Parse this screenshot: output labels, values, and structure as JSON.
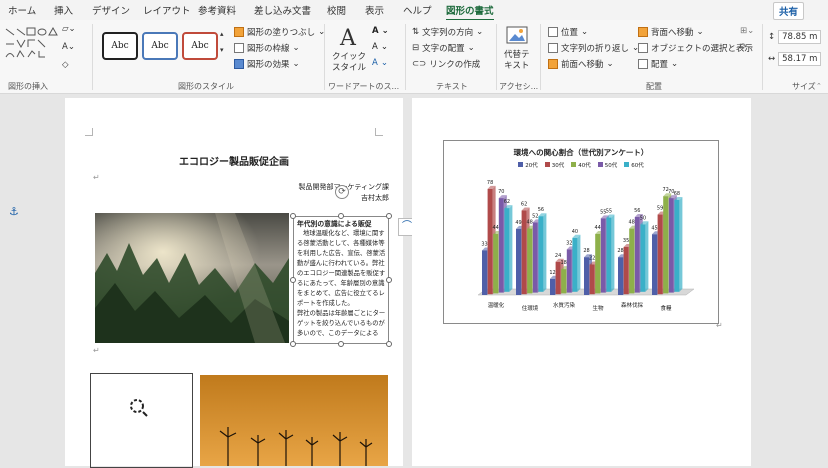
{
  "tabs": [
    "ホーム",
    "挿入",
    "デザイン",
    "レイアウト",
    "参考資料",
    "差し込み文書",
    "校閲",
    "表示",
    "ヘルプ",
    "図形の書式"
  ],
  "share_label": "共有",
  "ribbon": {
    "groups": {
      "insert_shapes": "図形の挿入",
      "shape_styles": "図形のスタイル",
      "wordart_styles": "ワードアートのス...",
      "text": "テキスト",
      "accessibility": "アクセシ...",
      "arrange": "配置",
      "size": "サイズ"
    },
    "style_preset_label": "Abc",
    "shape_fill": "図形の塗りつぶし",
    "shape_outline": "図形の枠線",
    "shape_effects": "図形の効果",
    "quick_styles": "クイック\nスタイル",
    "text_direction": "文字列の方向",
    "text_align": "文字の配置",
    "create_link": "リンクの作成",
    "alt_text": "代替テ\nキスト",
    "position": "位置",
    "wrap_text": "文字列の折り返し",
    "bring_forward": "前面へ移動",
    "send_backward": "背面へ移動",
    "selection_pane": "オブジェクトの選択と表示",
    "align": "配置",
    "height": "78.85 m",
    "width": "58.17 m"
  },
  "page1": {
    "title": "エコロジー製品販促企画",
    "dept": "製品開発部マーケティング課",
    "author": "吉村太郎",
    "textbox_heading": "年代別の意識による販促",
    "textbox_body": "地球温暖化など、環境に関する啓蒙活動として、各種媒体等を利用した広告、宣伝、啓蒙活動が盛んに行われている。弊社のエコロジー関連製品を販促するにあたって、年齢層別の意識をまとめて、広告に役立てるレポートを作成した。\n弊社の製品は年齢層ごとにターゲットを絞り込んでいるものが多いので、このデータによる"
  },
  "chart_data": {
    "type": "bar",
    "title": "環境への関心割合（世代別アンケート）",
    "categories": [
      "温暖化",
      "住環境",
      "水質汚染",
      "生物",
      "森林伐採",
      "食糧"
    ],
    "series": [
      {
        "name": "20代",
        "values": [
          33,
          49,
          12,
          28,
          28,
          45
        ]
      },
      {
        "name": "30代",
        "values": [
          78,
          62,
          24,
          22,
          35,
          59
        ]
      },
      {
        "name": "40代",
        "values": [
          44,
          48,
          18,
          44,
          48,
          72
        ]
      },
      {
        "name": "50代",
        "values": [
          70,
          52,
          32,
          55,
          56,
          70
        ]
      },
      {
        "name": "60代",
        "values": [
          62,
          56,
          40,
          55,
          50,
          68
        ]
      }
    ],
    "colors": [
      "#4f5fa8",
      "#b04a4a",
      "#8eb04a",
      "#7a5aa8",
      "#3ab0c8"
    ],
    "ylim": [
      0,
      80
    ],
    "legend_position": "top"
  }
}
